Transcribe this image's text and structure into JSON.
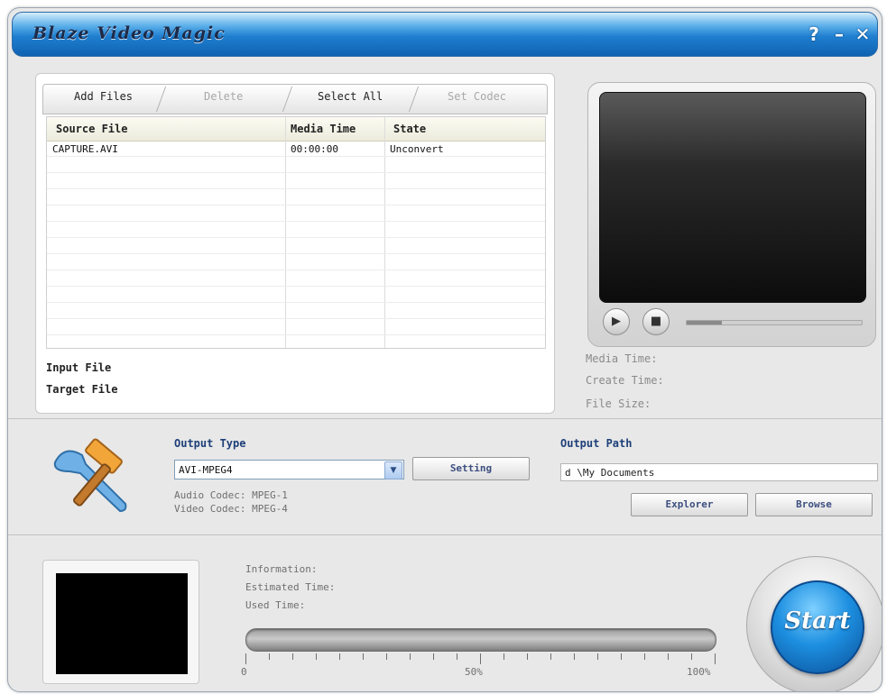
{
  "window": {
    "title": "Blaze Video Magic",
    "help_label": "?",
    "minimize_label": "–",
    "close_label": "✕"
  },
  "toolbar": {
    "add_files": "Add Files",
    "delete": "Delete",
    "select_all": "Select All",
    "set_codec": "Set Codec"
  },
  "file_list": {
    "columns": [
      "Source File",
      "Media Time",
      "State"
    ],
    "rows": [
      {
        "source": "CAPTURE.AVI",
        "media_time": "00:00:00",
        "state": "Unconvert"
      }
    ]
  },
  "file_info": {
    "input_label": "Input File",
    "target_label": "Target File"
  },
  "media_info": {
    "media_time": "Media Time:",
    "create_time": "Create Time:",
    "file_size": "File Size:"
  },
  "player": {
    "play_icon": "play-icon",
    "stop_icon": "stop-icon",
    "seek_position": 0.2
  },
  "output": {
    "type_label": "Output Type",
    "type_value": "AVI-MPEG4",
    "setting_button": "Setting",
    "audio_codec": "Audio Codec: MPEG-1",
    "video_codec": "Video Codec: MPEG-4",
    "path_label": "Output Path",
    "path_value": "d \\My Documents",
    "explorer_button": "Explorer",
    "browse_button": "Browse"
  },
  "progress": {
    "information": "Information:",
    "estimated_time": "Estimated Time:",
    "used_time": "Used Time:",
    "tick_0": "0",
    "tick_50": "50%",
    "tick_100": "100%",
    "value": 0
  },
  "start_button": "Start",
  "colors": {
    "title_bar": "#1f7fcf",
    "start_blue": "#1d8fe0",
    "label_blue": "#1e3f78"
  }
}
